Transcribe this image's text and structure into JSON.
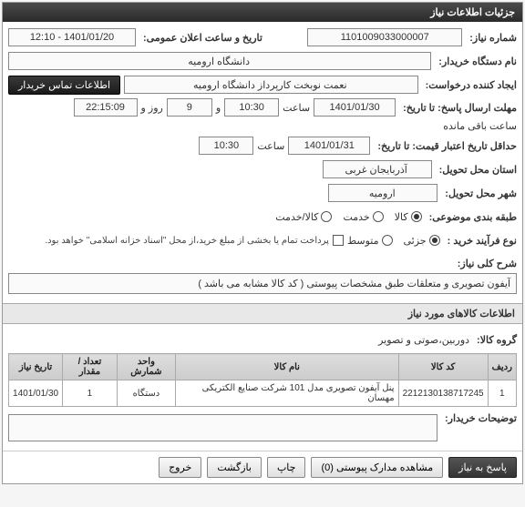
{
  "panel_title": "جزئیات اطلاعات نیاز",
  "fields": {
    "need_no_label": "شماره نیاز:",
    "need_no": "1101009033000007",
    "buyer_org_label": "نام دستگاه خریدار:",
    "buyer_org": "دانشگاه ارومیه",
    "announce_label": "تاریخ و ساعت اعلان عمومی:",
    "announce_val": "1401/01/20 - 12:10",
    "requester_label": "ایجاد کننده درخواست:",
    "requester_val": "نعمت نوبخت کارپرداز دانشگاه ارومیه",
    "contact_btn": "اطلاعات تماس خریدار",
    "deadline_label": "مهلت ارسال پاسخ: تا تاریخ:",
    "deadline_date": "1401/01/30",
    "time_label": "ساعت",
    "deadline_time": "10:30",
    "days_and": "و",
    "days_val": "9",
    "days_word": "روز و",
    "countdown": "22:15:09",
    "countdown_suffix": "ساعت باقی مانده",
    "price_valid_label": "حداقل تاریخ اعتبار قیمت: تا تاریخ:",
    "price_valid_date": "1401/01/31",
    "price_valid_time": "10:30",
    "province_label": "استان محل تحویل:",
    "province_val": "آذربایجان غربی",
    "city_label": "شهر محل تحویل:",
    "city_val": "ارومیه",
    "subject_class_label": "طبقه بندی موضوعی:",
    "subj_goods": "کالا",
    "subj_service": "خدمت",
    "subj_both": "کالا/خدمت",
    "proc_type_label": "نوع فرآیند خرید :",
    "proc_minor": "جزئی",
    "proc_medium": "متوسط",
    "proc_note": "پرداخت تمام یا بخشی از مبلغ خرید،از محل \"اسناد خزانه اسلامی\" خواهد بود.",
    "desc_label": "شرح کلی نیاز:",
    "desc_val": "آیفون تصویری و متعلقات طبق مشخصات پیوستی ( کد کالا مشابه می باشد )"
  },
  "items_section": {
    "title": "اطلاعات کالاهای مورد نیاز",
    "group_label": "گروه کالا:",
    "group_val": "دوربین،صوتی و تصویر"
  },
  "table": {
    "headers": [
      "ردیف",
      "کد کالا",
      "نام کالا",
      "واحد شمارش",
      "تعداد / مقدار",
      "تاریخ نیاز"
    ],
    "rows": [
      [
        "1",
        "2212130138717245",
        "پنل آیفون تصویری مدل 101 شرکت صنایع الکتریکی مهسان",
        "دستگاه",
        "1",
        "1401/01/30"
      ]
    ]
  },
  "buyer_notes_label": "توضیحات خریدار:",
  "buttons": {
    "reply": "پاسخ به نیاز",
    "attachments": "مشاهده مدارک پیوستی (0)",
    "print": "چاپ",
    "back": "بازگشت",
    "exit": "خروج"
  }
}
